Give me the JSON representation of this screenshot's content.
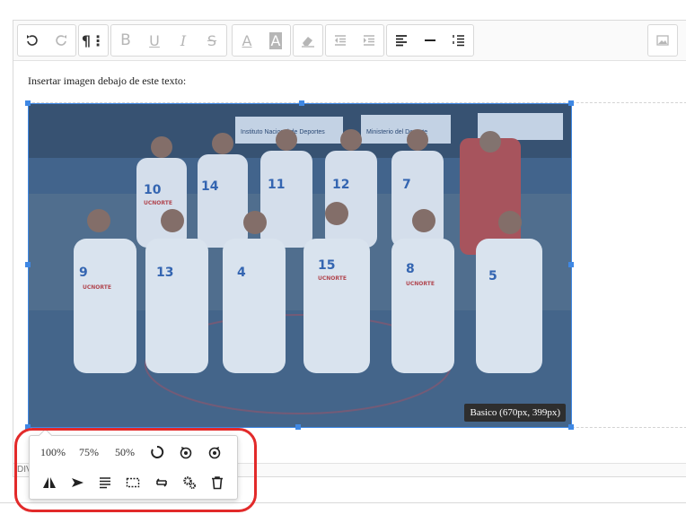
{
  "content": {
    "intro_text": "Insertar imagen debajo de este texto:",
    "image_alt": "Foto del equipo de básquetbol UCNORTE",
    "size_badge": "Basico (670px, 399px)"
  },
  "statusbar": {
    "path": "DIV"
  },
  "toolbar": {
    "undo": "undo-icon",
    "redo": "redo-icon",
    "paragraph": "paragraph-icon",
    "bold": "B",
    "underline": "U",
    "italic": "I",
    "strike": "S",
    "font_color": "A",
    "bg_color": "A"
  },
  "image_popover": {
    "size_100": "100%",
    "size_75": "75%",
    "size_50": "50%"
  },
  "jerseys": [
    "10",
    "14",
    "11",
    "12",
    "7",
    "9",
    "13",
    "4",
    "15",
    "8",
    "5"
  ],
  "banners": [
    "Instituto Nacional de Deportes",
    "Ministerio del Deporte"
  ],
  "team_logo": "UCNORTE",
  "colors": {
    "accent": "#3f88e4",
    "highlight": "#e22a2a"
  }
}
